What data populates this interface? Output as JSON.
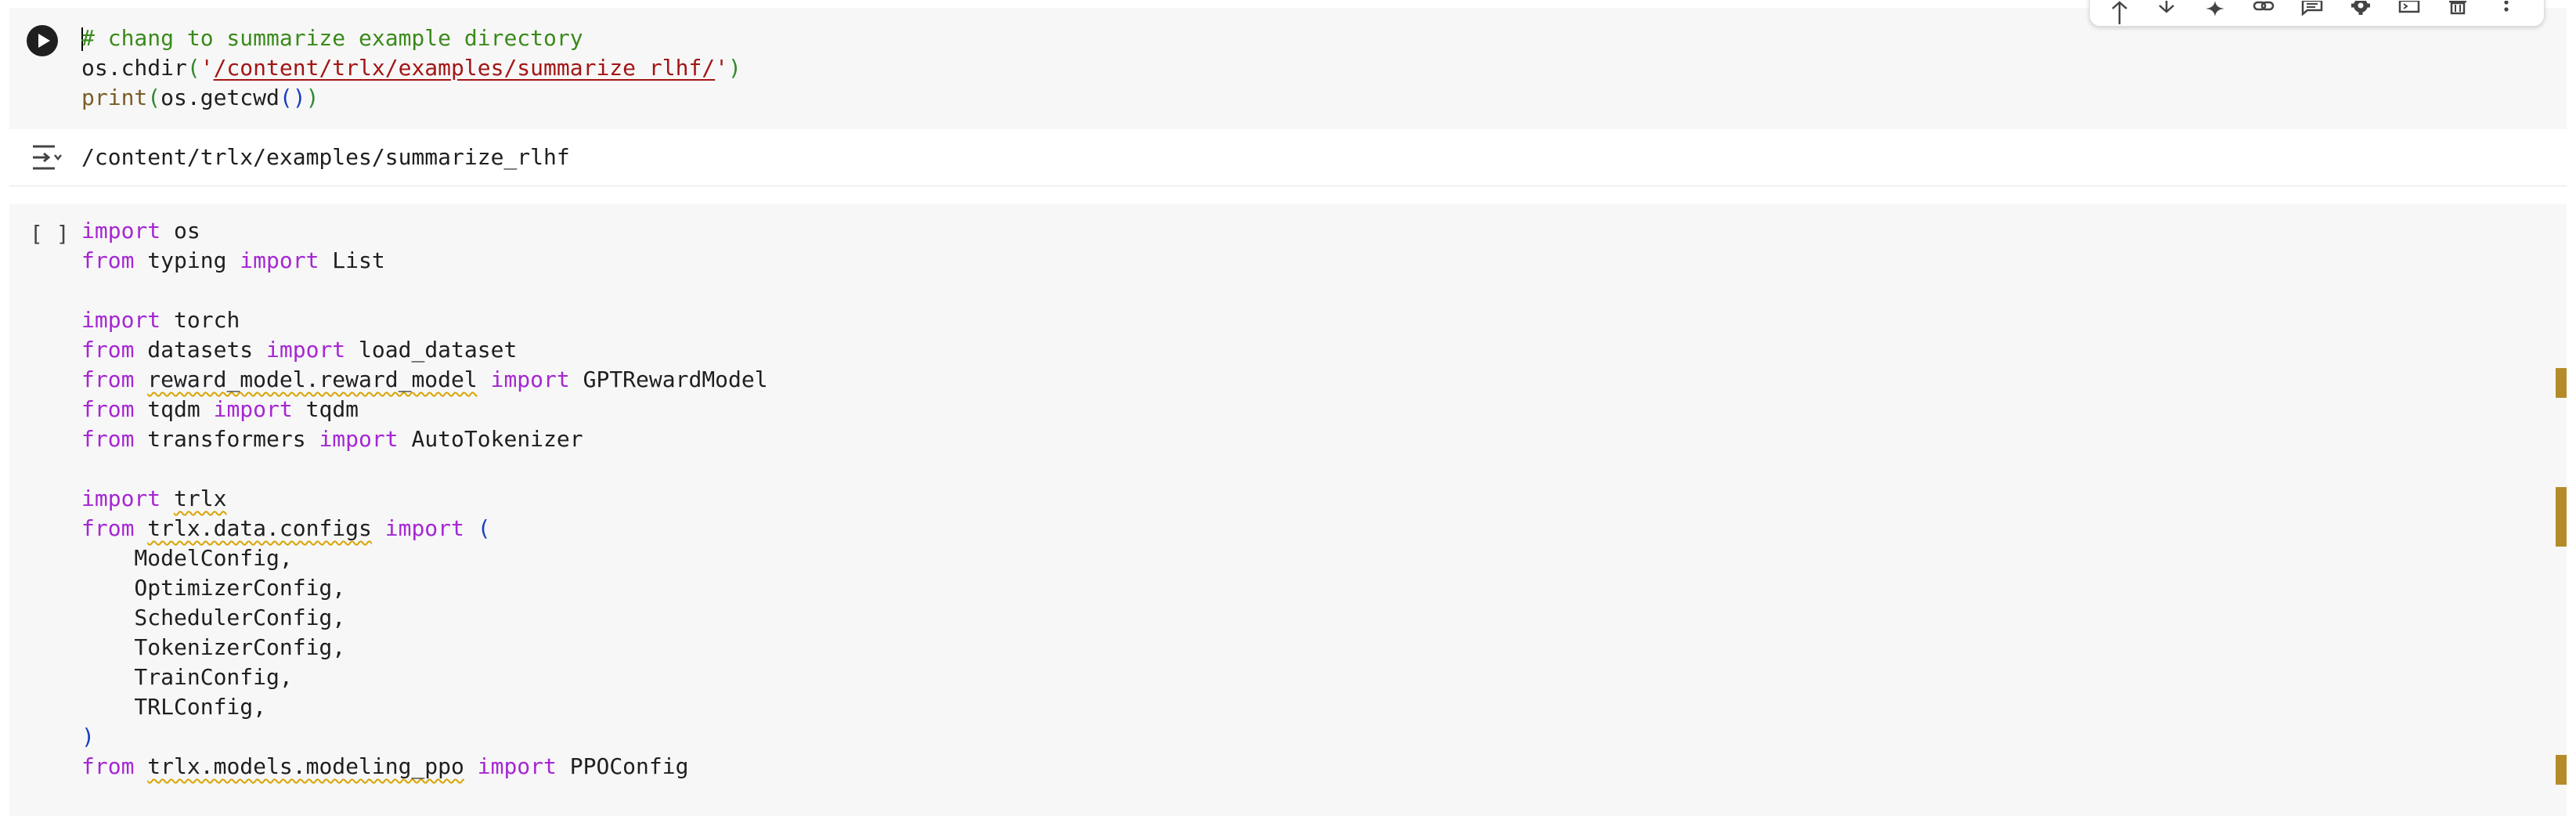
{
  "cell1": {
    "run_button_label": "Run cell",
    "lines": [
      [
        {
          "t": "caret"
        },
        {
          "t": "# chang to summarize example directory",
          "c": "cm"
        }
      ],
      [
        {
          "t": "os.chdir"
        },
        {
          "t": "(",
          "c": "pg"
        },
        {
          "t": "'",
          "c": "st"
        },
        {
          "t": "/content/trlx/examples/summarize_rlhf/",
          "c": "st lnk"
        },
        {
          "t": "'",
          "c": "st"
        },
        {
          "t": ")",
          "c": "pg"
        }
      ],
      [
        {
          "t": "print",
          "c": "fn"
        },
        {
          "t": "(",
          "c": "pg"
        },
        {
          "t": "os.getcwd"
        },
        {
          "t": "()",
          "c": "pr"
        },
        {
          "t": ")",
          "c": "pg"
        }
      ]
    ]
  },
  "output": {
    "text": "/content/trlx/examples/summarize_rlhf"
  },
  "cell2": {
    "execution_count": "[ ]",
    "lines": [
      [
        {
          "t": "import",
          "c": "kw"
        },
        {
          "t": " os"
        }
      ],
      [
        {
          "t": "from",
          "c": "kw"
        },
        {
          "t": " typing "
        },
        {
          "t": "import",
          "c": "kw"
        },
        {
          "t": " List"
        }
      ],
      [],
      [
        {
          "t": "import",
          "c": "kw"
        },
        {
          "t": " torch"
        }
      ],
      [
        {
          "t": "from",
          "c": "kw"
        },
        {
          "t": " datasets "
        },
        {
          "t": "import",
          "c": "kw"
        },
        {
          "t": " load_dataset"
        }
      ],
      [
        {
          "t": "from",
          "c": "kw"
        },
        {
          "t": " "
        },
        {
          "t": "reward_model.reward_model",
          "c": "sq"
        },
        {
          "t": " "
        },
        {
          "t": "import",
          "c": "kw"
        },
        {
          "t": " GPTRewardModel"
        }
      ],
      [
        {
          "t": "from",
          "c": "kw"
        },
        {
          "t": " tqdm "
        },
        {
          "t": "import",
          "c": "kw"
        },
        {
          "t": " tqdm"
        }
      ],
      [
        {
          "t": "from",
          "c": "kw"
        },
        {
          "t": " transformers "
        },
        {
          "t": "import",
          "c": "kw"
        },
        {
          "t": " AutoTokenizer"
        }
      ],
      [],
      [
        {
          "t": "import",
          "c": "kw"
        },
        {
          "t": " "
        },
        {
          "t": "trlx",
          "c": "sq"
        }
      ],
      [
        {
          "t": "from",
          "c": "kw"
        },
        {
          "t": " "
        },
        {
          "t": "trlx.data.configs",
          "c": "sq"
        },
        {
          "t": " "
        },
        {
          "t": "import",
          "c": "kw"
        },
        {
          "t": " "
        },
        {
          "t": "(",
          "c": "pr"
        }
      ],
      [
        {
          "t": "    ModelConfig,"
        }
      ],
      [
        {
          "t": "    OptimizerConfig,"
        }
      ],
      [
        {
          "t": "    SchedulerConfig,"
        }
      ],
      [
        {
          "t": "    TokenizerConfig,"
        }
      ],
      [
        {
          "t": "    TrainConfig,"
        }
      ],
      [
        {
          "t": "    TRLConfig,"
        }
      ],
      [
        {
          "t": ")",
          "c": "pr"
        }
      ],
      [
        {
          "t": "from",
          "c": "kw"
        },
        {
          "t": " "
        },
        {
          "t": "trlx.models.modeling_ppo",
          "c": "sq"
        },
        {
          "t": " "
        },
        {
          "t": "import",
          "c": "kw"
        },
        {
          "t": " PPOConfig"
        }
      ]
    ]
  },
  "toolbar": {
    "buttons": [
      "move-up-icon",
      "move-down-icon",
      "sparkle-icon",
      "link-icon",
      "comment-icon",
      "gear-icon",
      "mirror-cell-icon",
      "delete-icon",
      "more-vert-icon"
    ]
  },
  "colors": {
    "keyword": "#a626d3",
    "comment": "#3a8a1a",
    "string": "#a31515",
    "function": "#795e26",
    "cell_background": "#f7f7f7",
    "change_marker": "#b58b2a"
  }
}
